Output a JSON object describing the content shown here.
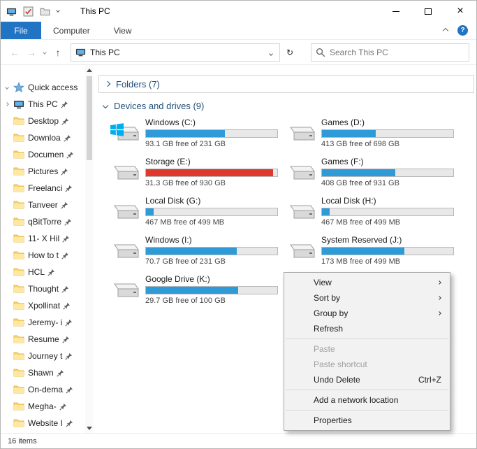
{
  "colors": {
    "file_tab": "#2173c4",
    "bar_blue": "#2e9bd8",
    "bar_red": "#e0382c",
    "group_header": "#1f4e79"
  },
  "titlebar": {
    "title": "This PC"
  },
  "icons": {
    "back": "←",
    "forward": "→",
    "up": "↑",
    "refresh": "↻",
    "close": "×",
    "help": "?"
  },
  "ribbon": {
    "tabs": [
      {
        "label": "File"
      },
      {
        "label": "Computer"
      },
      {
        "label": "View"
      }
    ]
  },
  "navbar": {
    "address": "This PC",
    "search_placeholder": "Search This PC"
  },
  "sidebar": {
    "items": [
      {
        "label": "Quick access",
        "icon": "star",
        "expand": "down",
        "pinned": false
      },
      {
        "label": "This PC",
        "icon": "pc",
        "expand": "right",
        "pinned": true
      },
      {
        "label": "Desktop",
        "icon": "folder",
        "pinned": true
      },
      {
        "label": "Downloa",
        "icon": "folder",
        "pinned": true
      },
      {
        "label": "Documen",
        "icon": "folder",
        "pinned": true
      },
      {
        "label": "Pictures",
        "icon": "folder",
        "pinned": true
      },
      {
        "label": "Freelanci",
        "icon": "folder",
        "pinned": true
      },
      {
        "label": "Tanveer",
        "icon": "folder",
        "pinned": true
      },
      {
        "label": "qBitTorre",
        "icon": "folder",
        "pinned": true
      },
      {
        "label": "11- X Hil",
        "icon": "folder",
        "pinned": true
      },
      {
        "label": "How to t",
        "icon": "folder",
        "pinned": true
      },
      {
        "label": "HCL",
        "icon": "folder",
        "pinned": true
      },
      {
        "label": "Thought",
        "icon": "folder",
        "pinned": true
      },
      {
        "label": "Xpollinat",
        "icon": "folder",
        "pinned": true
      },
      {
        "label": "Jeremy- i",
        "icon": "folder",
        "pinned": true
      },
      {
        "label": "Resume",
        "icon": "folder",
        "pinned": true
      },
      {
        "label": "Journey t",
        "icon": "folder",
        "pinned": true
      },
      {
        "label": "Shawn",
        "icon": "folder",
        "pinned": true
      },
      {
        "label": "On-dema",
        "icon": "folder",
        "pinned": true
      },
      {
        "label": "Megha-",
        "icon": "folder",
        "pinned": true
      },
      {
        "label": "Website I",
        "icon": "folder",
        "pinned": true
      }
    ]
  },
  "content": {
    "groups": [
      {
        "label": "Folders",
        "count": "(7)",
        "collapsed": true
      },
      {
        "label": "Devices and drives",
        "count": "(9)",
        "collapsed": false
      }
    ],
    "drives": [
      {
        "name": "Windows (C:)",
        "free": "93.1 GB free of 231 GB",
        "pct": 60,
        "full": false,
        "logo": true
      },
      {
        "name": "Games (D:)",
        "free": "413 GB free of 698 GB",
        "pct": 41,
        "full": false,
        "logo": false
      },
      {
        "name": "Storage (E:)",
        "free": "31.3 GB free of 930 GB",
        "pct": 97,
        "full": true,
        "logo": false
      },
      {
        "name": "Games (F:)",
        "free": "408 GB free of 931 GB",
        "pct": 56,
        "full": false,
        "logo": false
      },
      {
        "name": "Local Disk (G:)",
        "free": "467 MB free of 499 MB",
        "pct": 6,
        "full": false,
        "logo": false
      },
      {
        "name": "Local Disk (H:)",
        "free": "467 MB free of 499 MB",
        "pct": 6,
        "full": false,
        "logo": false
      },
      {
        "name": "Windows (I:)",
        "free": "70.7 GB free of 231 GB",
        "pct": 69,
        "full": false,
        "logo": false
      },
      {
        "name": "System Reserved (J:)",
        "free": "173 MB free of 499 MB",
        "pct": 63,
        "full": false,
        "logo": false
      },
      {
        "name": "Google Drive (K:)",
        "free": "29.7 GB free of 100 GB",
        "pct": 70,
        "full": false,
        "logo": false
      }
    ]
  },
  "context_menu": {
    "items": [
      {
        "label": "View",
        "submenu": true
      },
      {
        "label": "Sort by",
        "submenu": true
      },
      {
        "label": "Group by",
        "submenu": true
      },
      {
        "label": "Refresh"
      },
      {
        "separator": true
      },
      {
        "label": "Paste",
        "disabled": true
      },
      {
        "label": "Paste shortcut",
        "disabled": true
      },
      {
        "label": "Undo Delete",
        "shortcut": "Ctrl+Z"
      },
      {
        "separator": true
      },
      {
        "label": "Add a network location"
      },
      {
        "separator": true
      },
      {
        "label": "Properties"
      }
    ]
  },
  "statusbar": {
    "text": "16 items"
  }
}
